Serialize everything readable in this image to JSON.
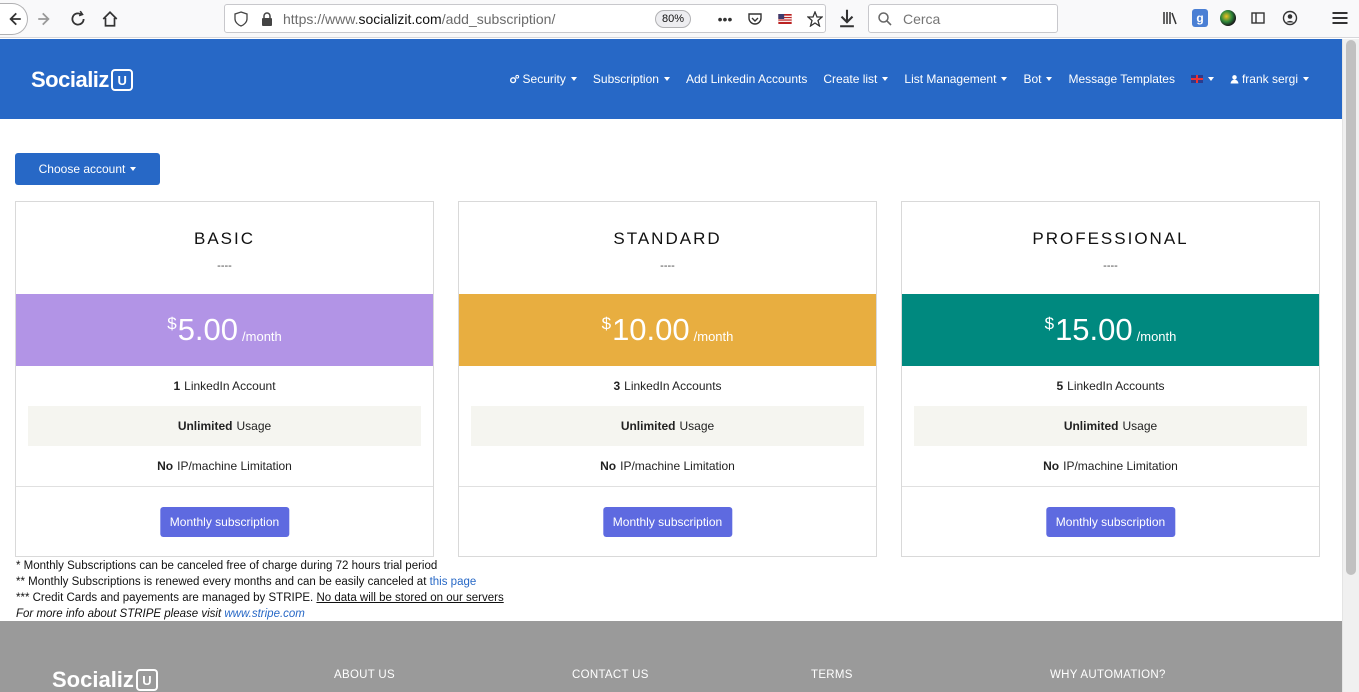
{
  "browser": {
    "url_prefix": "https://www.",
    "url_host": "socializit.com",
    "url_path": "/add_subscription/",
    "zoom": "80%",
    "search_placeholder": "Cerca"
  },
  "site": {
    "brand": "Socializ",
    "brand_mark": "U",
    "nav": {
      "security": "Security",
      "subscription": "Subscription",
      "add_linkedin": "Add Linkedin Accounts",
      "create_list": "Create list",
      "list_management": "List Management",
      "bot": "Bot",
      "message_templates": "Message Templates",
      "user": "frank sergi"
    }
  },
  "choose_account": "Choose account",
  "plans": [
    {
      "name": "BASIC",
      "dashes": "----",
      "currency": "$",
      "price": "5.00",
      "period": "/month",
      "color": "#b294e6",
      "f1_bold": "1",
      "f1_text": "LinkedIn Account",
      "f2_bold": "Unlimited",
      "f2_text": "Usage",
      "f3_bold": "No",
      "f3_text": "IP/machine Limitation",
      "button": "Monthly subscription"
    },
    {
      "name": "STANDARD",
      "dashes": "----",
      "currency": "$",
      "price": "10.00",
      "period": "/month",
      "color": "#e8ae40",
      "f1_bold": "3",
      "f1_text": "LinkedIn Accounts",
      "f2_bold": "Unlimited",
      "f2_text": "Usage",
      "f3_bold": "No",
      "f3_text": "IP/machine Limitation",
      "button": "Monthly subscription"
    },
    {
      "name": "PROFESSIONAL",
      "dashes": "----",
      "currency": "$",
      "price": "15.00",
      "period": "/month",
      "color": "#00897f",
      "f1_bold": "5",
      "f1_text": "LinkedIn Accounts",
      "f2_bold": "Unlimited",
      "f2_text": "Usage",
      "f3_bold": "No",
      "f3_text": "IP/machine Limitation",
      "button": "Monthly subscription"
    }
  ],
  "notes": {
    "n1": "* Monthly Subscriptions can be canceled free of charge during 72 hours trial period",
    "n2_text": "** Monthly Subscriptions is renewed every months and can be easily canceled at",
    "n2_link": "this page",
    "n3_text": "*** Credit Cards and payements are managed by STRIPE.",
    "n3_underline": "No data will be stored on our servers",
    "n4_text": "For more info about STRIPE please visit",
    "n4_link": "www.stripe.com"
  },
  "footer": {
    "brand": "Socializ",
    "brand_mark": "U",
    "about": "ABOUT US",
    "contact": "CONTACT US",
    "terms": "TERMS",
    "why": "WHY AUTOMATION?"
  }
}
